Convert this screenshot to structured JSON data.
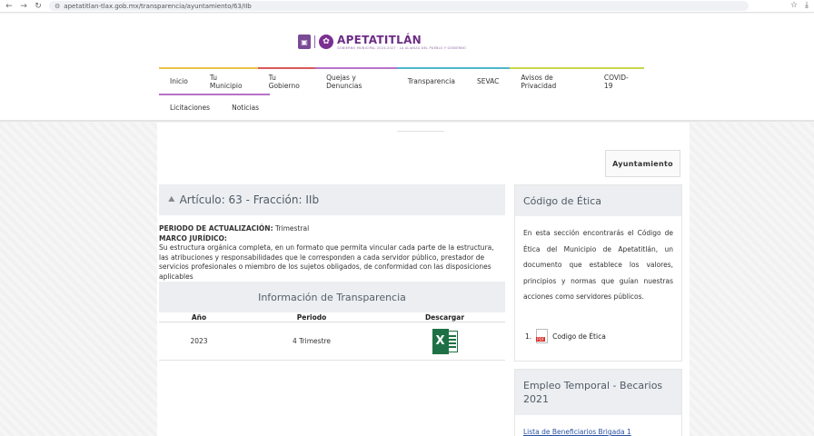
{
  "browser": {
    "url": "apetatitlan-tlax.gob.mx/transparencia/ayuntamiento/63/IIb"
  },
  "header": {
    "logo_title": "APETATITLÁN",
    "logo_subtitle": "GOBIERNO MUNICIPAL 2024-2027 · LA ALIANZA DEL PUEBLO Y GOBIERNO"
  },
  "nav": {
    "row1": [
      {
        "label": "Inicio",
        "color": "#e9c24b"
      },
      {
        "label": "Tu Municipio",
        "color": "#e9c24b"
      },
      {
        "label": "Tu Gobierno",
        "color": "#d95a5a"
      },
      {
        "label": "Quejas y Denuncias",
        "color": "#b772c9"
      },
      {
        "label": "Transparencia",
        "color": "#4db7c9"
      },
      {
        "label": "SEVAC",
        "color": "#4db7c9"
      },
      {
        "label": "Avisos de Privacidad",
        "color": "#c9d64d"
      },
      {
        "label": "COVID-19",
        "color": "#c9d64d"
      }
    ],
    "row2": [
      {
        "label": "Licitaciones",
        "color": "#b772c9"
      },
      {
        "label": "Noticias",
        "color": "#b772c9"
      }
    ]
  },
  "breadcrumb": "Ayuntamiento",
  "article": {
    "title": "Artículo: 63 - Fracción: IIb",
    "period_label": "PERIODO DE ACTUALIZACIÓN:",
    "period_value": "Trimestral",
    "legal_label": "MARCO JURÍDICO:",
    "legal_text": "Su estructura orgánica completa, en un formato que permita vincular cada parte de la estructura, las atribuciones y responsabilidades que le corresponden a cada servidor público, prestador de servicios profesionales o miembro de los sujetos obligados, de conformidad con las disposiciones aplicables"
  },
  "transparency": {
    "title": "Información de Transparencia",
    "columns": [
      "Año",
      "Periodo",
      "Descargar"
    ],
    "rows": [
      {
        "year": "2023",
        "period": "4 Trimestre",
        "download_icon": "excel-icon"
      }
    ]
  },
  "ethics_card": {
    "title": "Código de Ética",
    "text": "En esta sección encontrarás el Código de Ética del Municipio de Apetatitlán, un documento que establece los valores, principios y normas que guían nuestras acciones como servidores públicos.",
    "item_number": "1.",
    "item_label": "Codigo de Ética"
  },
  "temp_card": {
    "title": "Empleo Temporal - Becarios 2021",
    "link": "Lista de Beneficiarios Brigada 1"
  }
}
